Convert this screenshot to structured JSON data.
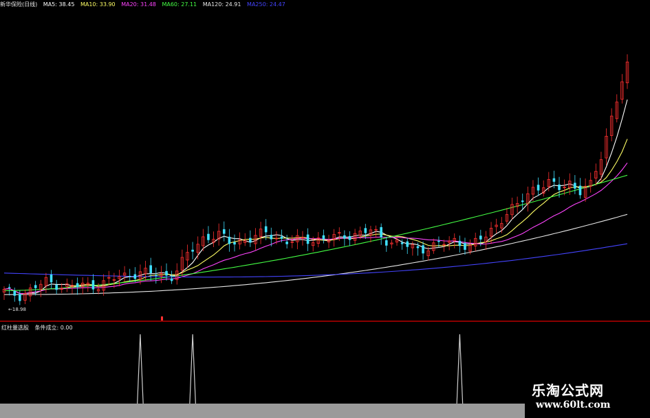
{
  "header": {
    "title": "新华保险(日线)",
    "ma": [
      {
        "label": "MA5: 38.45",
        "color": "#ffffff"
      },
      {
        "label": "MA10: 33.90",
        "color": "#ffff66"
      },
      {
        "label": "MA20: 31.48",
        "color": "#ff44ff"
      },
      {
        "label": "MA60: 27.11",
        "color": "#44ff44"
      },
      {
        "label": "MA120: 24.91",
        "color": "#e8e8e8"
      },
      {
        "label": "MA250: 24.47",
        "color": "#4444ff"
      }
    ]
  },
  "indicator": {
    "name": "红柱量选股",
    "condition": "条件成立: 0.00"
  },
  "low_label": "←18.98",
  "watermark": {
    "title": "乐淘公式网",
    "url": "www.60lt.com"
  },
  "colors": {
    "up": "#ff3030",
    "down": "#40e0ff",
    "background": "#000000",
    "signal_line": "#cfcfcf"
  },
  "chart_data": [
    {
      "type": "candlestick",
      "title": "新华保险(日线)",
      "x": {
        "count": 120,
        "unit": "trading day index"
      },
      "ylim": [
        17,
        48
      ],
      "grid": false,
      "ohlc_keypoints": [
        {
          "day": 0,
          "close": 19.6
        },
        {
          "day": 3,
          "close": 19.2
        },
        {
          "day": 8,
          "close": 20.6
        },
        {
          "day": 12,
          "close": 20.1
        },
        {
          "day": 18,
          "close": 20.3
        },
        {
          "day": 22,
          "close": 21.1
        },
        {
          "day": 26,
          "close": 21.6
        },
        {
          "day": 28,
          "close": 21.4
        },
        {
          "day": 32,
          "close": 21.2
        },
        {
          "day": 35,
          "close": 23.3
        },
        {
          "day": 38,
          "close": 25.1
        },
        {
          "day": 41,
          "close": 25.4
        },
        {
          "day": 43,
          "close": 24.6
        },
        {
          "day": 47,
          "close": 25.0
        },
        {
          "day": 50,
          "close": 25.6
        },
        {
          "day": 54,
          "close": 24.7
        },
        {
          "day": 58,
          "close": 24.9
        },
        {
          "day": 62,
          "close": 25.0
        },
        {
          "day": 66,
          "close": 25.4
        },
        {
          "day": 70,
          "close": 25.8
        },
        {
          "day": 73,
          "close": 24.9
        },
        {
          "day": 76,
          "close": 24.4
        },
        {
          "day": 79,
          "close": 23.9
        },
        {
          "day": 83,
          "close": 24.4
        },
        {
          "day": 86,
          "close": 24.8
        },
        {
          "day": 89,
          "close": 24.2
        },
        {
          "day": 92,
          "close": 25.3
        },
        {
          "day": 95,
          "close": 27.1
        },
        {
          "day": 98,
          "close": 28.4
        },
        {
          "day": 101,
          "close": 30.2
        },
        {
          "day": 104,
          "close": 30.6
        },
        {
          "day": 106,
          "close": 30.2
        },
        {
          "day": 108,
          "close": 30.8
        },
        {
          "day": 110,
          "close": 29.8
        },
        {
          "day": 112,
          "close": 30.4
        },
        {
          "day": 114,
          "close": 33.5
        },
        {
          "day": 116,
          "close": 37.5
        },
        {
          "day": 118,
          "close": 41.0
        },
        {
          "day": 119,
          "close": 42.5
        }
      ],
      "series": [
        {
          "name": "MA5",
          "color": "#ffffff",
          "period": 5
        },
        {
          "name": "MA10",
          "color": "#ffff66",
          "period": 10
        },
        {
          "name": "MA20",
          "color": "#ff44ff",
          "period": 20
        },
        {
          "name": "MA60",
          "color": "#44ff44",
          "period": 60
        },
        {
          "name": "MA120",
          "color": "#e8e8e8",
          "period": 120
        },
        {
          "name": "MA250",
          "color": "#4444ff",
          "period": 250
        }
      ],
      "annotations": [
        {
          "text": "←18.98",
          "x": 3,
          "y": 18.98
        }
      ]
    },
    {
      "type": "line",
      "title": "红柱量选股",
      "x": {
        "count": 120,
        "unit": "trading day index"
      },
      "ylim": [
        0,
        1
      ],
      "signals_at_days": [
        26,
        36,
        87
      ],
      "values_note_label": "条件成立: 0.00"
    }
  ]
}
